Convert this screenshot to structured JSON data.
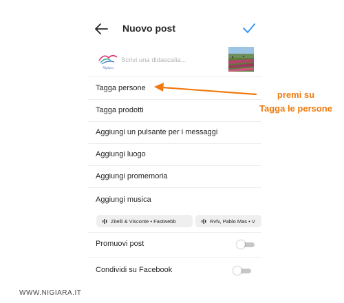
{
  "header": {
    "title": "Nuovo post",
    "back_icon": "arrow-left-icon",
    "confirm_icon": "checkmark-icon",
    "accent_color": "#3897f0"
  },
  "caption": {
    "placeholder": "Scrivi una didascalia...",
    "avatar_icon": "nigiara-logo-avatar",
    "avatar_text": "Nigiara",
    "thumbnail": "flower-field-photo"
  },
  "menu": [
    {
      "label": "Tagga persone"
    },
    {
      "label": "Tagga prodotti"
    },
    {
      "label": "Aggiungi un pulsante per i messaggi"
    },
    {
      "label": "Aggiungi luogo"
    },
    {
      "label": "Aggiungi promemoria"
    },
    {
      "label": "Aggiungi musica"
    }
  ],
  "music_chips": [
    {
      "label": "Zitelli & Visconte • Fastwebb",
      "icon": "audio-wave-icon"
    },
    {
      "label": "Rvfv, Pablo Mas • V",
      "icon": "audio-wave-icon"
    }
  ],
  "toggles": [
    {
      "label": "Promuovi post",
      "on": false
    },
    {
      "label": "Condividi su Facebook",
      "on": false
    }
  ],
  "annotation": {
    "line1": "premi su",
    "line2": "Tagga le persone",
    "color": "#f07a0e"
  },
  "watermark": "WWW.NIGIARA.IT"
}
